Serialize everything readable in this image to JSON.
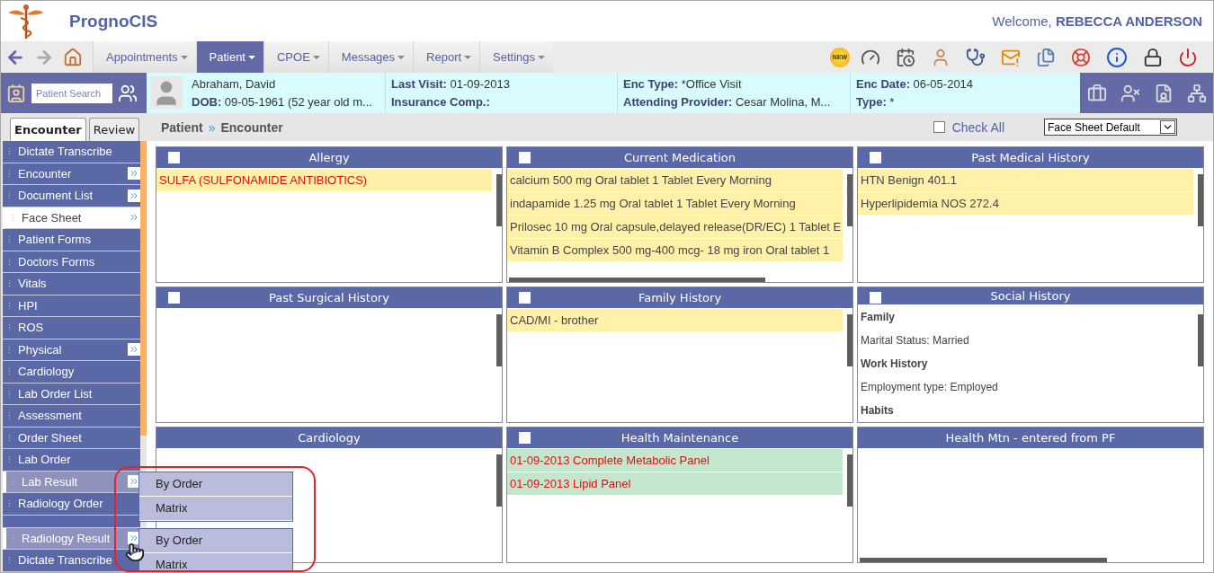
{
  "header": {
    "app_name": "PrognoCIS",
    "welcome": "Welcome,",
    "user": "REBECCA ANDERSON"
  },
  "nav": {
    "tabs": [
      {
        "label": "Appointments",
        "selected": false
      },
      {
        "label": "Patient",
        "selected": true
      },
      {
        "label": "CPOE",
        "selected": false
      },
      {
        "label": "Messages",
        "selected": false
      },
      {
        "label": "Report",
        "selected": false
      },
      {
        "label": "Settings",
        "selected": false
      }
    ],
    "new_badge": "NEW"
  },
  "patient_bar": {
    "search_placeholder": "Patient Search",
    "name": "Abraham, David",
    "fields": [
      {
        "label": "DOB:",
        "value": "09-05-1961 (52 year old m..."
      },
      {
        "label": "Last Visit:",
        "value": "01-09-2013"
      },
      {
        "label": "Insurance Comp.:"
      },
      {
        "label": "Enc Type:",
        "value": "*Office Visit"
      },
      {
        "label": "Attending Provider:",
        "value": "Cesar Molina, M..."
      },
      {
        "label": "Enc Date:",
        "value": "06-05-2014"
      },
      {
        "label": "Type:",
        "value": "*"
      }
    ]
  },
  "sidebar": {
    "tabs": [
      {
        "label": "Encounter",
        "selected": true
      },
      {
        "label": "Review",
        "selected": false
      }
    ],
    "items": [
      {
        "kind": "item",
        "label": "Dictate Transcribe",
        "expandable": false,
        "selected": false,
        "hovered": false
      },
      {
        "kind": "item",
        "label": "Encounter",
        "expandable": true,
        "selected": false,
        "hovered": false
      },
      {
        "kind": "item",
        "label": "Document List",
        "expandable": true,
        "selected": false,
        "hovered": false
      },
      {
        "kind": "item",
        "label": "Face Sheet",
        "expandable": true,
        "selected": true,
        "hovered": false
      },
      {
        "kind": "item",
        "label": "Patient Forms",
        "expandable": false,
        "selected": false,
        "hovered": false
      },
      {
        "kind": "item",
        "label": "Doctors Forms",
        "expandable": false,
        "selected": false,
        "hovered": false
      },
      {
        "kind": "item",
        "label": "Vitals",
        "expandable": false,
        "selected": false,
        "hovered": false
      },
      {
        "kind": "item",
        "label": "HPI",
        "expandable": false,
        "selected": false,
        "hovered": false
      },
      {
        "kind": "item",
        "label": "ROS",
        "expandable": false,
        "selected": false,
        "hovered": false
      },
      {
        "kind": "item",
        "label": "Physical",
        "expandable": true,
        "selected": false,
        "hovered": false
      },
      {
        "kind": "item",
        "label": "Cardiology",
        "expandable": false,
        "selected": false,
        "hovered": false
      },
      {
        "kind": "item",
        "label": "Lab Order List",
        "expandable": false,
        "selected": false,
        "hovered": false
      },
      {
        "kind": "item",
        "label": "Assessment",
        "expandable": false,
        "selected": false,
        "hovered": false
      },
      {
        "kind": "item",
        "label": "Order Sheet",
        "expandable": false,
        "selected": false,
        "hovered": false
      },
      {
        "kind": "item",
        "label": "Lab Order",
        "expandable": false,
        "selected": false,
        "hovered": false
      },
      {
        "kind": "item",
        "label": "Lab Result",
        "expandable": true,
        "selected": false,
        "hovered": true,
        "submenu": [
          "By Order",
          "Matrix"
        ]
      },
      {
        "kind": "item",
        "label": "Radiology Order",
        "expandable": false,
        "selected": false,
        "hovered": false
      },
      {
        "kind": "spacer"
      },
      {
        "kind": "item",
        "label": "Radiology Result",
        "expandable": true,
        "selected": false,
        "hovered": true,
        "submenu": [
          "By Order",
          "Matrix"
        ]
      },
      {
        "kind": "item",
        "label": "Dictate Transcribe",
        "expandable": false,
        "selected": false,
        "hovered": false
      }
    ]
  },
  "breadcrumb": {
    "parts": [
      "Patient",
      "»",
      "Encounter"
    ],
    "check_all": {
      "label": "Check All",
      "checked": false
    },
    "view_select": "Face Sheet Default"
  },
  "panels": [
    {
      "title": "Allergy",
      "checked": false,
      "vertical_scrollbar": true,
      "horizontal_scrollbar": false,
      "items": [
        {
          "kind": "entry",
          "text": "SULFA (SULFONAMIDE ANTIBIOTICS)",
          "color": "#fff2a8",
          "alert": true
        }
      ]
    },
    {
      "title": "Current Medication",
      "checked": false,
      "vertical_scrollbar": true,
      "horizontal_scrollbar": true,
      "items": [
        {
          "kind": "entry",
          "text": "calcium 500 mg Oral tablet 1 Tablet Every Morning",
          "color": "#fff2a8",
          "alert": false
        },
        {
          "kind": "entry",
          "text": "indapamide 1.25 mg Oral tablet 1 Tablet Every Morning",
          "color": "#fff2a8",
          "alert": false
        },
        {
          "kind": "entry",
          "text": "Prilosec 10 mg Oral capsule,delayed release(DR/EC) 1 Tablet E",
          "color": "#fff2a8",
          "alert": false
        },
        {
          "kind": "entry",
          "text": "Vitamin B Complex 500 mg-400 mcg- 18 mg iron Oral tablet 1",
          "color": "#fff2a8",
          "alert": false
        }
      ]
    },
    {
      "title": "Past Medical History",
      "checked": false,
      "vertical_scrollbar": true,
      "horizontal_scrollbar": false,
      "items": [
        {
          "kind": "entry",
          "text": "HTN Benign 401.1",
          "color": "#fff2a8",
          "alert": false
        },
        {
          "kind": "entry",
          "text": "Hyperlipidemia NOS 272.4",
          "color": "#fff2a8",
          "alert": false
        }
      ]
    },
    {
      "title": "Past Surgical History",
      "checked": false,
      "vertical_scrollbar": true,
      "horizontal_scrollbar": false
    },
    {
      "title": "Family History",
      "checked": false,
      "vertical_scrollbar": true,
      "horizontal_scrollbar": false,
      "items": [
        {
          "kind": "entry",
          "text": "CAD/MI - brother",
          "color": "#fff2a8",
          "alert": false
        }
      ]
    },
    {
      "title": "Social History",
      "checked": false,
      "vertical_scrollbar": true,
      "horizontal_scrollbar": false,
      "items": [
        {
          "kind": "heading",
          "text": "Family"
        },
        {
          "kind": "text",
          "text": "Marital Status: Married"
        },
        {
          "kind": "heading",
          "text": "Work History"
        },
        {
          "kind": "text",
          "text": "Employment type: Employed"
        },
        {
          "kind": "heading",
          "text": "Habits"
        }
      ]
    },
    {
      "title": "Cardiology",
      "vertical_scrollbar": true,
      "horizontal_scrollbar": false
    },
    {
      "title": "Health Maintenance",
      "checked": false,
      "vertical_scrollbar": true,
      "horizontal_scrollbar": false,
      "items": [
        {
          "kind": "entry",
          "text": "01-09-2013 Complete Metabolic Panel",
          "color": "#c3e6cd",
          "alert": true
        },
        {
          "kind": "entry",
          "text": "01-09-2013 Lipid Panel",
          "color": "#c3e6cd",
          "alert": true
        }
      ]
    },
    {
      "title": "Health Mtn - entered from PF",
      "vertical_scrollbar": false,
      "horizontal_scrollbar": true
    }
  ]
}
